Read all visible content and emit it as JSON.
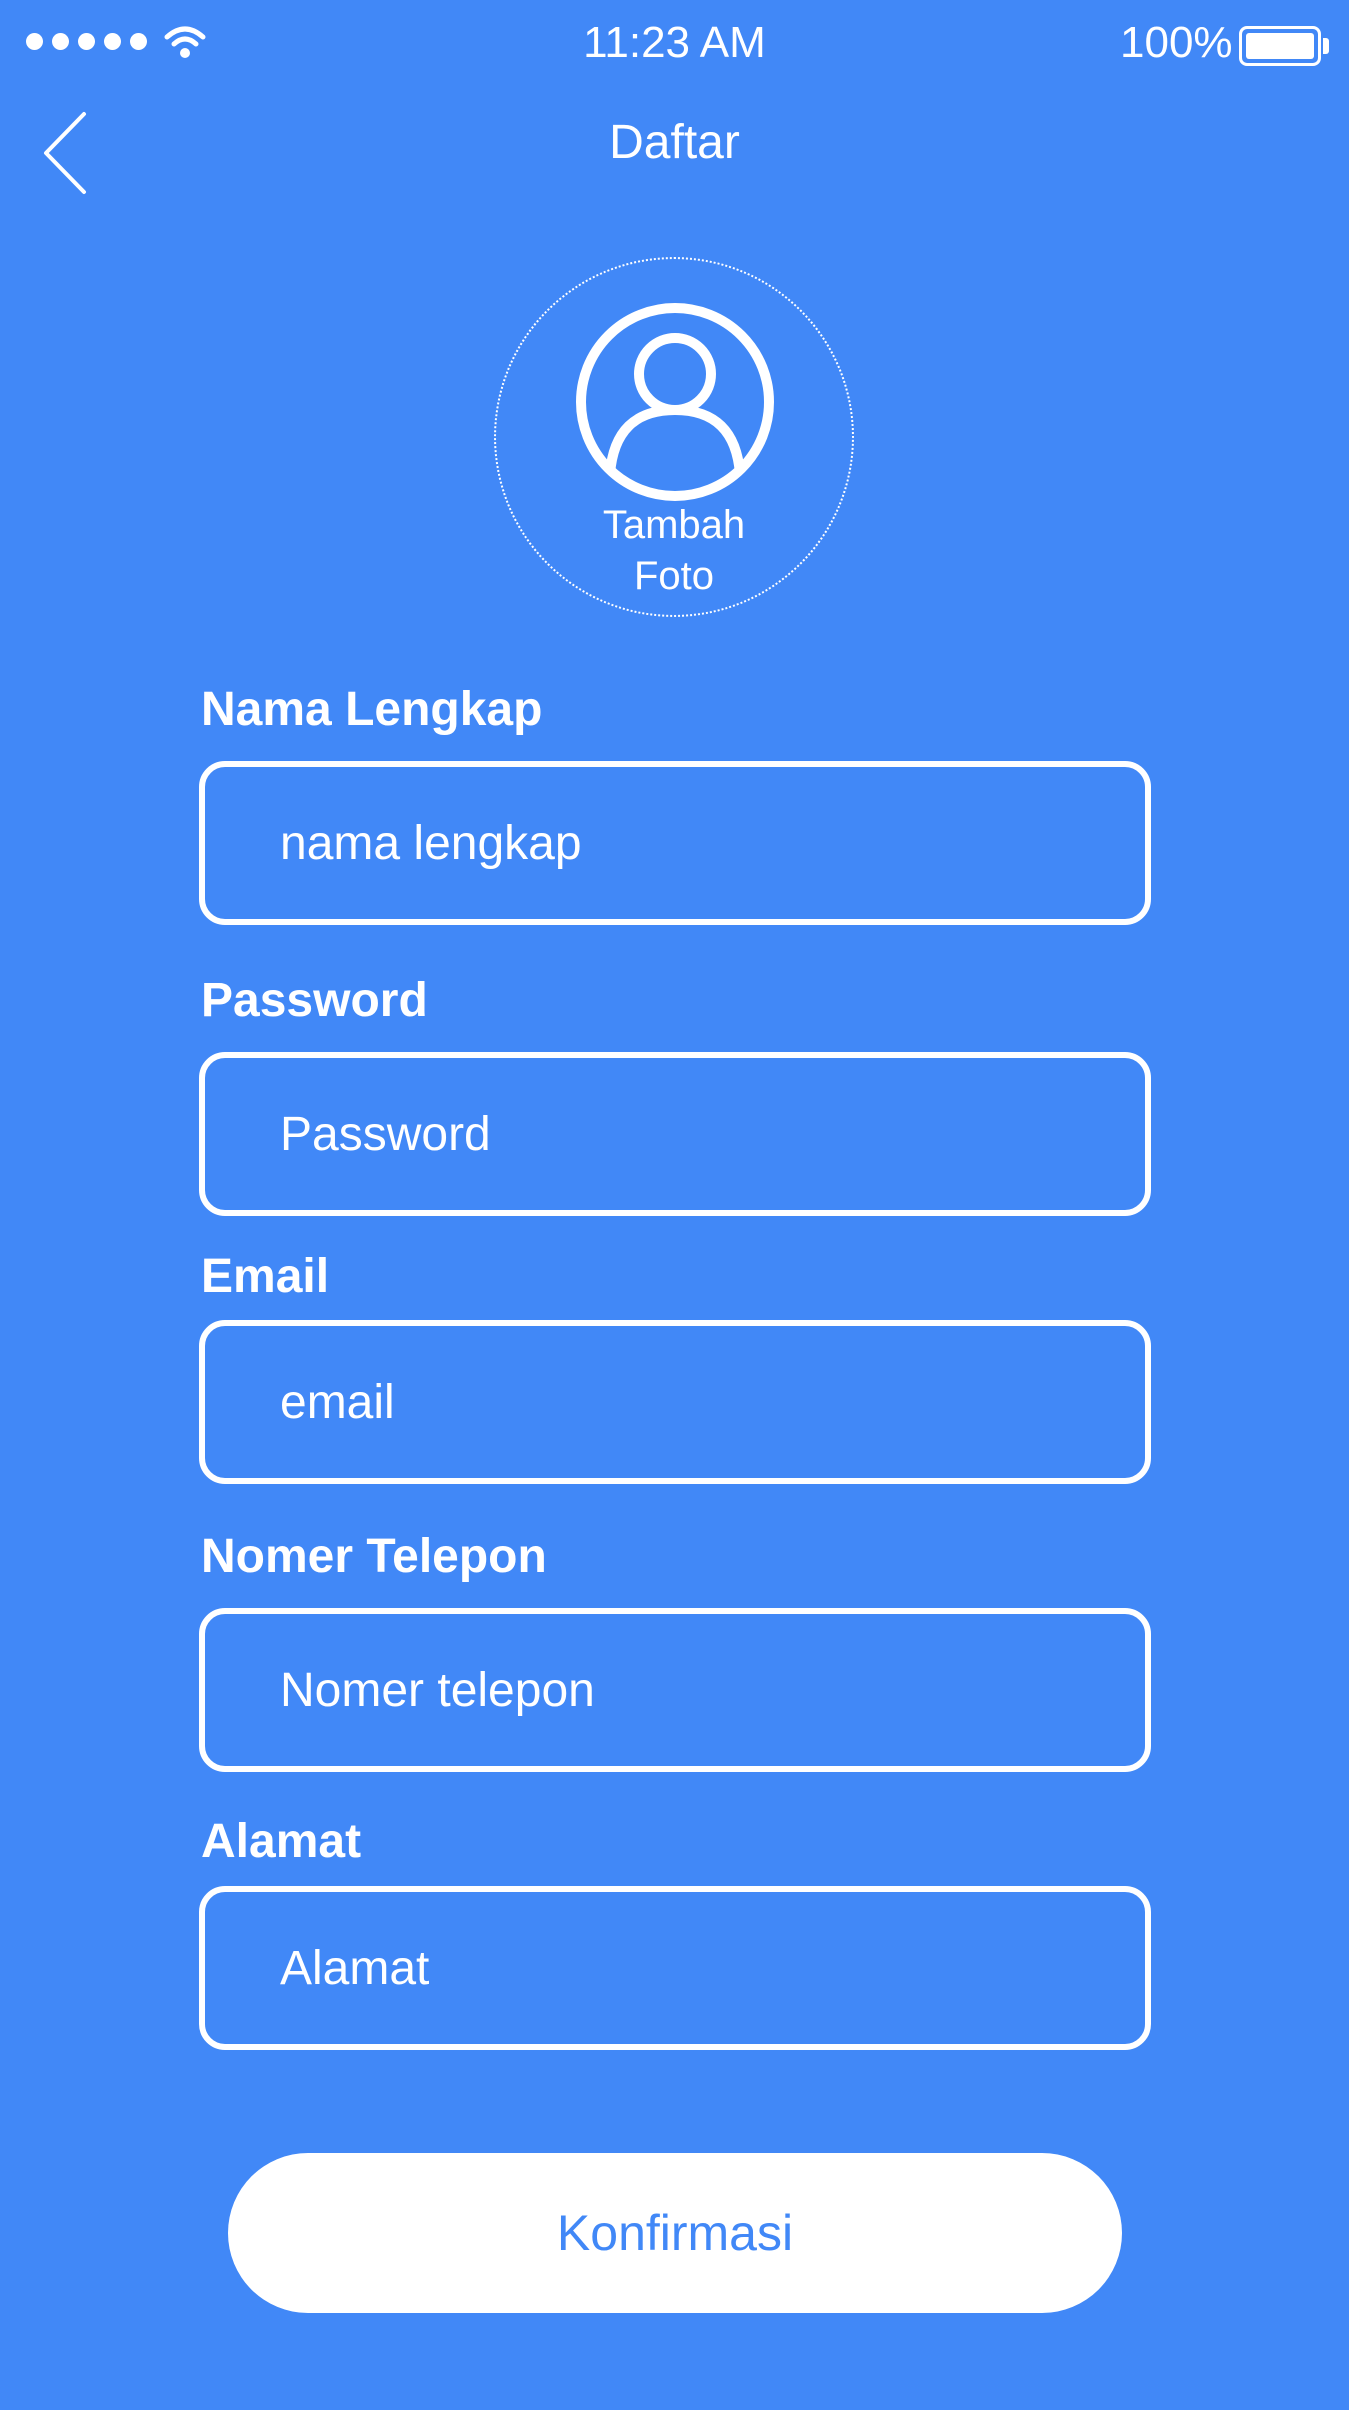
{
  "status_bar": {
    "time": "11:23 AM",
    "battery_percent": "100%",
    "signal_icon": "signal-dots-icon",
    "wifi_icon": "wifi-icon",
    "battery_icon": "battery-icon"
  },
  "nav": {
    "title": "Daftar",
    "back_icon": "chevron-left-icon"
  },
  "photo": {
    "label_line1": "Tambah",
    "label_line2": "Foto",
    "icon": "user-avatar-icon"
  },
  "form": {
    "full_name": {
      "label": "Nama Lengkap",
      "placeholder": "nama lengkap"
    },
    "password": {
      "label": "Password",
      "placeholder": "Password"
    },
    "email": {
      "label": "Email",
      "placeholder": "email"
    },
    "phone": {
      "label": "Nomer Telepon",
      "placeholder": "Nomer telepon"
    },
    "address": {
      "label": "Alamat",
      "placeholder": "Alamat"
    }
  },
  "confirm_button": {
    "label": "Konfirmasi"
  },
  "colors": {
    "background": "#4188f7",
    "foreground": "#ffffff"
  }
}
